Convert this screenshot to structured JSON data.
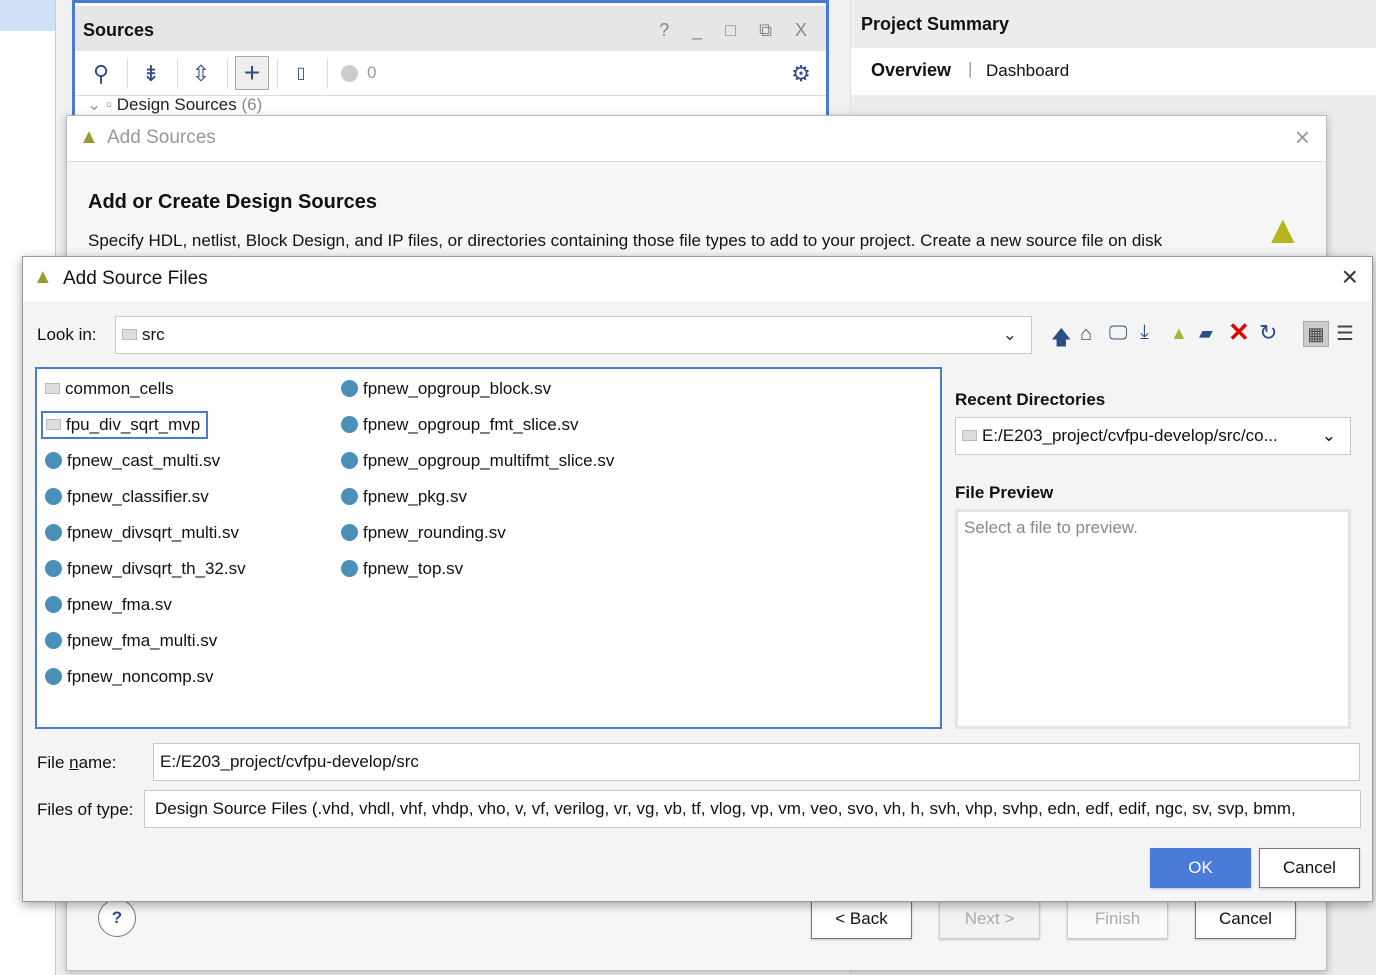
{
  "sources_panel": {
    "title": "Sources",
    "window_buttons": "? _ □ ⧉ X",
    "counter": "0",
    "tree_item": "Design Sources",
    "tree_count": "(6)"
  },
  "project_summary": {
    "title": "Project Summary",
    "tabs": [
      "Overview",
      "Dashboard"
    ]
  },
  "add_sources": {
    "title": "Add Sources",
    "heading": "Add or Create Design Sources",
    "description": "Specify HDL, netlist, Block Design, and IP files, or directories containing those file types to add to your project. Create a new source file on disk",
    "buttons": {
      "help": "?",
      "back": "< Back",
      "next": "Next >",
      "finish": "Finish",
      "cancel": "Cancel"
    }
  },
  "add_source_files": {
    "title": "Add Source Files",
    "look_in_label": "Look in:",
    "look_in_value": "src",
    "toolbar_icons": [
      "arrow-up-icon",
      "home-icon",
      "desktop-icon",
      "download-icon",
      "vivado-logo-icon",
      "new-folder-icon",
      "delete-icon",
      "refresh-icon",
      "grid-view-icon",
      "list-view-icon"
    ],
    "files_col1": [
      {
        "name": "common_cells",
        "type": "folder"
      },
      {
        "name": "fpu_div_sqrt_mvp",
        "type": "folder"
      },
      {
        "name": "fpnew_cast_multi.sv",
        "type": "file"
      },
      {
        "name": "fpnew_classifier.sv",
        "type": "file"
      },
      {
        "name": "fpnew_divsqrt_multi.sv",
        "type": "file"
      },
      {
        "name": "fpnew_divsqrt_th_32.sv",
        "type": "file"
      },
      {
        "name": "fpnew_fma.sv",
        "type": "file"
      },
      {
        "name": "fpnew_fma_multi.sv",
        "type": "file"
      },
      {
        "name": "fpnew_noncomp.sv",
        "type": "file"
      }
    ],
    "files_col2": [
      {
        "name": "fpnew_opgroup_block.sv",
        "type": "file"
      },
      {
        "name": "fpnew_opgroup_fmt_slice.sv",
        "type": "file"
      },
      {
        "name": "fpnew_opgroup_multifmt_slice.sv",
        "type": "file"
      },
      {
        "name": "fpnew_pkg.sv",
        "type": "file"
      },
      {
        "name": "fpnew_rounding.sv",
        "type": "file"
      },
      {
        "name": "fpnew_top.sv",
        "type": "file"
      }
    ],
    "recent_label": "Recent Directories",
    "recent_value": "E:/E203_project/cvfpu-develop/src/co...",
    "preview_label": "File Preview",
    "preview_placeholder": "Select a file to preview.",
    "file_name_label": "File name:",
    "file_name_value": "E:/E203_project/cvfpu-develop/src",
    "file_type_label": "Files of type:",
    "file_type_value": "Design Source Files (.vhd, vhdl, vhf, vhdp, vho, v, vf, verilog, vr, vg, vb, tf, vlog, vp, vm, veo, svo, vh, h, svh, vhp, svhp, edn, edf, edif, ngc, sv, svp, bmm,",
    "ok": "OK",
    "cancel": "Cancel"
  },
  "colors": {
    "accent": "#4a7bd0",
    "file_dot": "#4a90b8",
    "delete": "#e00000"
  }
}
